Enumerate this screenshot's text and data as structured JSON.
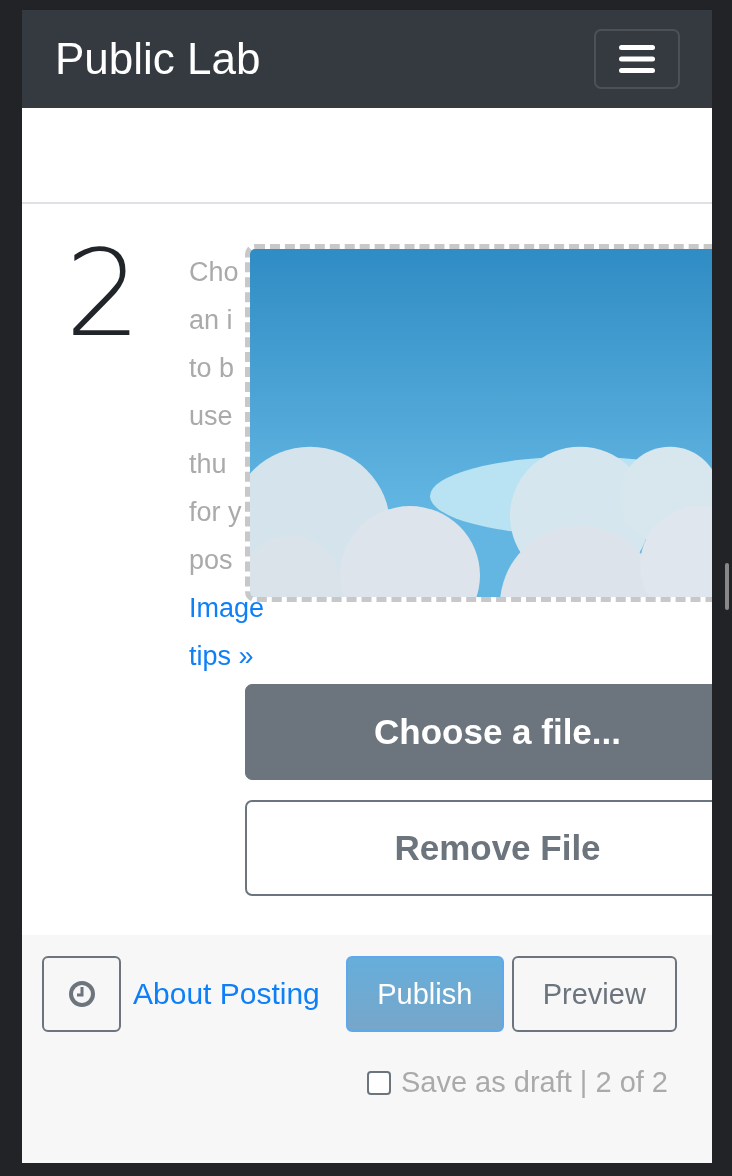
{
  "navbar": {
    "brand": "Public Lab"
  },
  "step": {
    "number": "2",
    "description_lines": [
      "Cho",
      "an i",
      "to b",
      "use",
      "thu",
      "for y",
      "pos"
    ],
    "tips_link": "Image tips »",
    "buttons": [
      {
        "label": "Choose a file...",
        "kind": "primary"
      },
      {
        "label": "Remove File",
        "kind": "outline"
      }
    ]
  },
  "footer": {
    "about_link": "About Posting",
    "publish": "Publish",
    "preview": "Preview",
    "draft": {
      "label": "Save as draft | 2 of 2",
      "checked": false
    }
  }
}
